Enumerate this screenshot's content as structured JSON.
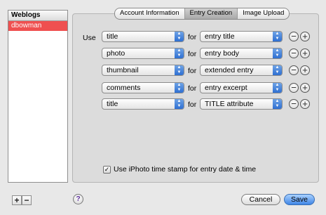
{
  "weblogs": {
    "header": "Weblogs",
    "items": [
      {
        "label": "dbowman",
        "selected": true
      }
    ]
  },
  "list_controls": {
    "add": "+",
    "remove": "−"
  },
  "tabs": [
    {
      "label": "Account Information",
      "active": false
    },
    {
      "label": "Entry Creation",
      "active": true
    },
    {
      "label": "Image Upload",
      "active": false
    }
  ],
  "mapping": {
    "use_label": "Use",
    "for_label": "for",
    "rows": [
      {
        "source": "title",
        "target": "entry title"
      },
      {
        "source": "photo",
        "target": "entry body"
      },
      {
        "source": "thumbnail",
        "target": "extended entry"
      },
      {
        "source": "comments",
        "target": "entry excerpt"
      },
      {
        "source": "title",
        "target": "TITLE attribute"
      }
    ],
    "remove_symbol": "−",
    "add_symbol": "+"
  },
  "checkbox": {
    "checked": true,
    "label": "Use iPhoto time stamp for entry date & time",
    "mark": "✓"
  },
  "footer": {
    "help": "?",
    "cancel": "Cancel",
    "save": "Save"
  },
  "colors": {
    "selection": "#ef5050",
    "save_button": "#3f86e6"
  }
}
